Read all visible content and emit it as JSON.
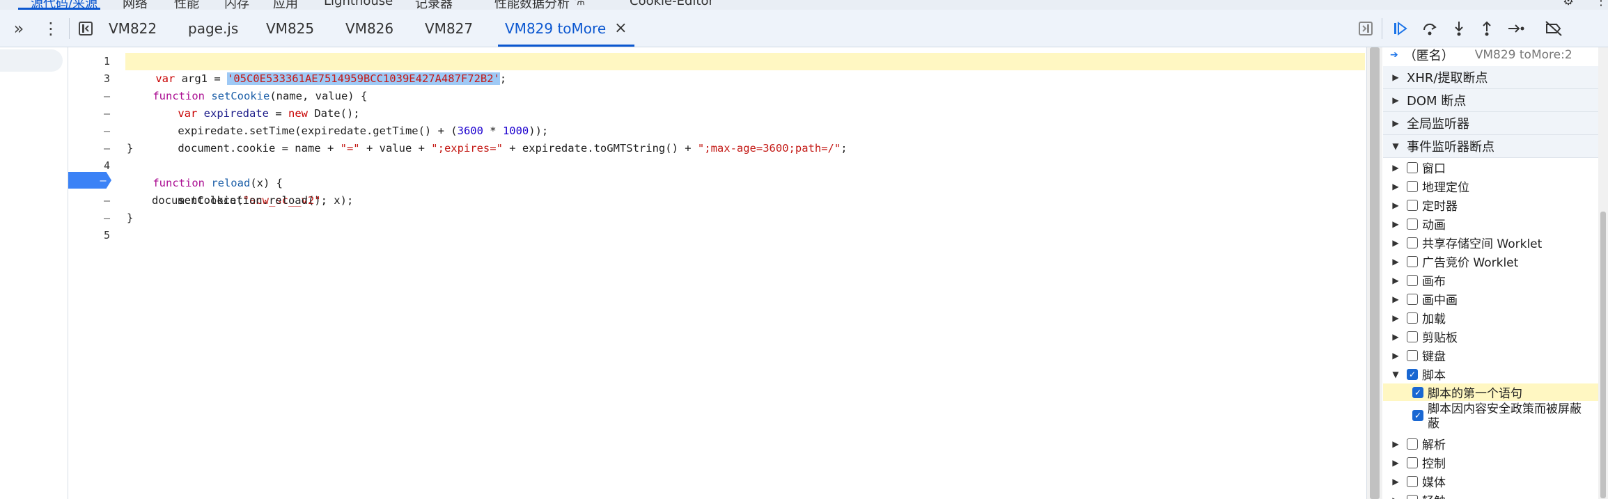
{
  "top_tabs": [
    {
      "label": "源代码/来源",
      "active": true
    },
    {
      "label": "网络"
    },
    {
      "label": "性能"
    },
    {
      "label": "内存"
    },
    {
      "label": "应用"
    },
    {
      "label": "Lighthouse"
    },
    {
      "label": "记录器"
    },
    {
      "label": "性能数据分析"
    },
    {
      "label": "Cookie-Editor"
    }
  ],
  "file_tabs": {
    "items": [
      "VM822",
      "page.js",
      "VM825",
      "VM826",
      "VM827",
      "VM829 toMore"
    ],
    "active": "VM829 toMore",
    "close_glyph": "×"
  },
  "gutter": {
    "line_numbers": [
      "1",
      "3",
      "–",
      "–",
      "–",
      "–",
      "4",
      "–",
      "–",
      "–",
      "5"
    ]
  },
  "code": {
    "line1": {
      "kw": "var",
      "name": " arg1 = ",
      "string": "'05C0E533361AE7514959BCC1039E427A487F72B2'",
      "end": ";"
    },
    "line2": {
      "kw": "function",
      "fn": " setCookie",
      "params": "(name, value) {"
    },
    "line3": {
      "kw": "var",
      "def": " expiredate",
      "op": " = ",
      "kw2": "new",
      "rest": " Date();"
    },
    "line4": {
      "pre": "expiredate.setTime(expiredate.getTime() + (",
      "n1": "3600",
      "mid": " * ",
      "n2": "1000",
      "post": "));"
    },
    "line5": {
      "pre": "document.cookie = name + ",
      "s1": "\"=\"",
      "mid1": " + value + ",
      "s2": "\";expires=\"",
      "mid2": " + expiredate.toGMTString() + ",
      "s3": "\";max-age=3600;path=/\"",
      "end": ";"
    },
    "line6": "}",
    "line7": {
      "kw": "function",
      "fn": " reload",
      "params": "(x) {"
    },
    "line8": {
      "pre": "setCookie(",
      "s": "\"acw_sc__v2\"",
      "post": ", x);"
    },
    "line9": "document.location.reload();",
    "line10": "}"
  },
  "debugger": {
    "call_frame": {
      "name": "（匿名）",
      "location": "VM829 toMore:2"
    },
    "sections": [
      "XHR/提取断点",
      "DOM 断点",
      "全局监听器",
      "事件监听器断点"
    ],
    "categories": [
      {
        "label": "窗口",
        "checked": false,
        "expanded": false
      },
      {
        "label": "地理定位",
        "checked": false,
        "expanded": false
      },
      {
        "label": "定时器",
        "checked": false,
        "expanded": false
      },
      {
        "label": "动画",
        "checked": false,
        "expanded": false
      },
      {
        "label": "共享存储空间 Worklet",
        "checked": false,
        "expanded": false
      },
      {
        "label": "广告竞价 Worklet",
        "checked": false,
        "expanded": false
      },
      {
        "label": "画布",
        "checked": false,
        "expanded": false
      },
      {
        "label": "画中画",
        "checked": false,
        "expanded": false
      },
      {
        "label": "加载",
        "checked": false,
        "expanded": false
      },
      {
        "label": "剪贴板",
        "checked": false,
        "expanded": false
      },
      {
        "label": "键盘",
        "checked": false,
        "expanded": false
      },
      {
        "label": "脚本",
        "checked": true,
        "expanded": true
      }
    ],
    "script_children": [
      {
        "label": "脚本的第一个语句",
        "checked": true
      },
      {
        "label": "脚本因内容安全政策而被屏蔽",
        "label_line2": "蔽",
        "checked": true
      }
    ],
    "more_categories": [
      {
        "label": "解析",
        "checked": false
      },
      {
        "label": "控制",
        "checked": false
      },
      {
        "label": "媒体",
        "checked": false
      },
      {
        "label": "轻触",
        "checked": false
      }
    ]
  },
  "colors": {
    "accent": "#0b57d0",
    "breakpoint": "#3b82f6",
    "highlight": "#fff7c2"
  }
}
